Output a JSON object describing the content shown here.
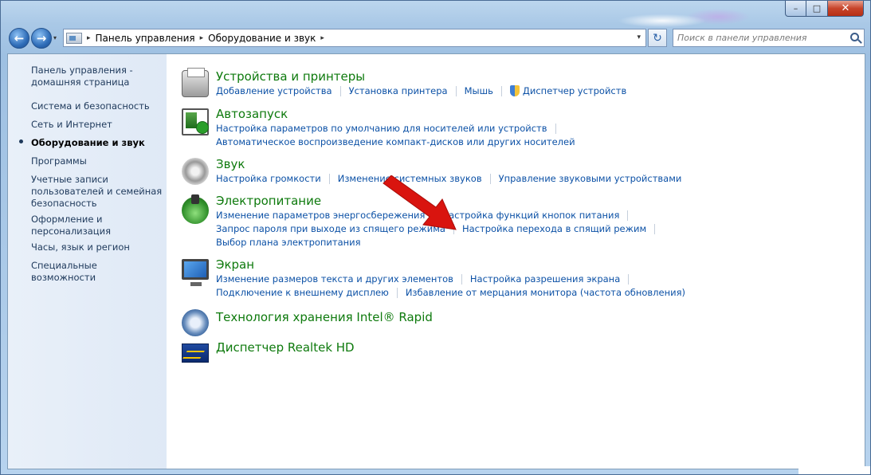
{
  "window": {
    "minimize": "–",
    "maximize": "□",
    "close": "✕"
  },
  "nav": {
    "back_icon": "←",
    "forward_icon": "→",
    "history_dropdown": "▾"
  },
  "address": {
    "crumbs": [
      "Панель управления",
      "Оборудование и звук"
    ],
    "arrow": "▸",
    "dropdown": "▾",
    "refresh_icon": "↻"
  },
  "search": {
    "placeholder": "Поиск в панели управления"
  },
  "sidebar": {
    "items": [
      "Панель управления -",
      "домашняя страница",
      "Система и безопасность",
      "Сеть и Интернет",
      "Оборудование и звук",
      "Программы",
      "Учетные записи",
      "пользователей и семейная",
      "безопасность",
      "Оформление и",
      "персонализация",
      "Часы, язык и регион",
      "Специальные возможности"
    ]
  },
  "categories": {
    "devices": {
      "title": "Устройства и принтеры",
      "links": [
        "Добавление устройства",
        "Установка принтера",
        "Мышь",
        "Диспетчер устройств"
      ]
    },
    "autoplay": {
      "title": "Автозапуск",
      "links": [
        "Настройка параметров по умолчанию для носителей или устройств",
        "Автоматическое воспроизведение компакт-дисков или других носителей"
      ]
    },
    "sound": {
      "title": "Звук",
      "links": [
        "Настройка громкости",
        "Изменение системных звуков",
        "Управление звуковыми устройствами"
      ]
    },
    "power": {
      "title": "Электропитание",
      "links": [
        "Изменение параметров энергосбережения",
        "Настройка функций кнопок питания",
        "Запрос пароля при выходе из спящего режима",
        "Настройка перехода в спящий режим",
        "Выбор плана электропитания"
      ]
    },
    "display": {
      "title": "Экран",
      "links": [
        "Изменение размеров текста и других элементов",
        "Настройка разрешения экрана",
        "Подключение к внешнему дисплею",
        "Избавление от мерцания монитора (частота обновления)"
      ]
    },
    "intel": {
      "title": "Технология хранения Intel® Rapid"
    },
    "realtek": {
      "title": "Диспетчер Realtek HD"
    }
  },
  "colors": {
    "category_title": "#0e7a0d",
    "link": "#0c51a6",
    "annotation_arrow": "#d9140f"
  }
}
